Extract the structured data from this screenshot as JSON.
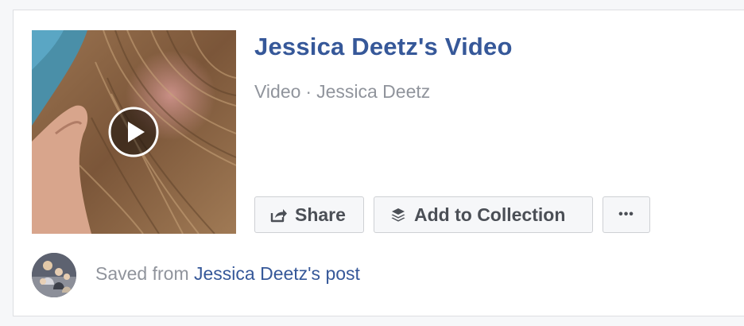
{
  "item": {
    "title": "Jessica Deetz's Video",
    "type": "Video",
    "separator": "·",
    "author": "Jessica Deetz",
    "play_icon": "play-circle-icon"
  },
  "actions": {
    "share_label": "Share",
    "share_icon": "share-arrow-icon",
    "collection_label": "Add to Collection",
    "collection_icon": "stack-layers-icon",
    "more_label": "•••"
  },
  "source": {
    "prefix": "Saved from",
    "link": "Jessica Deetz's post"
  },
  "colors": {
    "link_blue": "#365899",
    "meta_gray": "#90949c",
    "button_text": "#4b4f56"
  }
}
